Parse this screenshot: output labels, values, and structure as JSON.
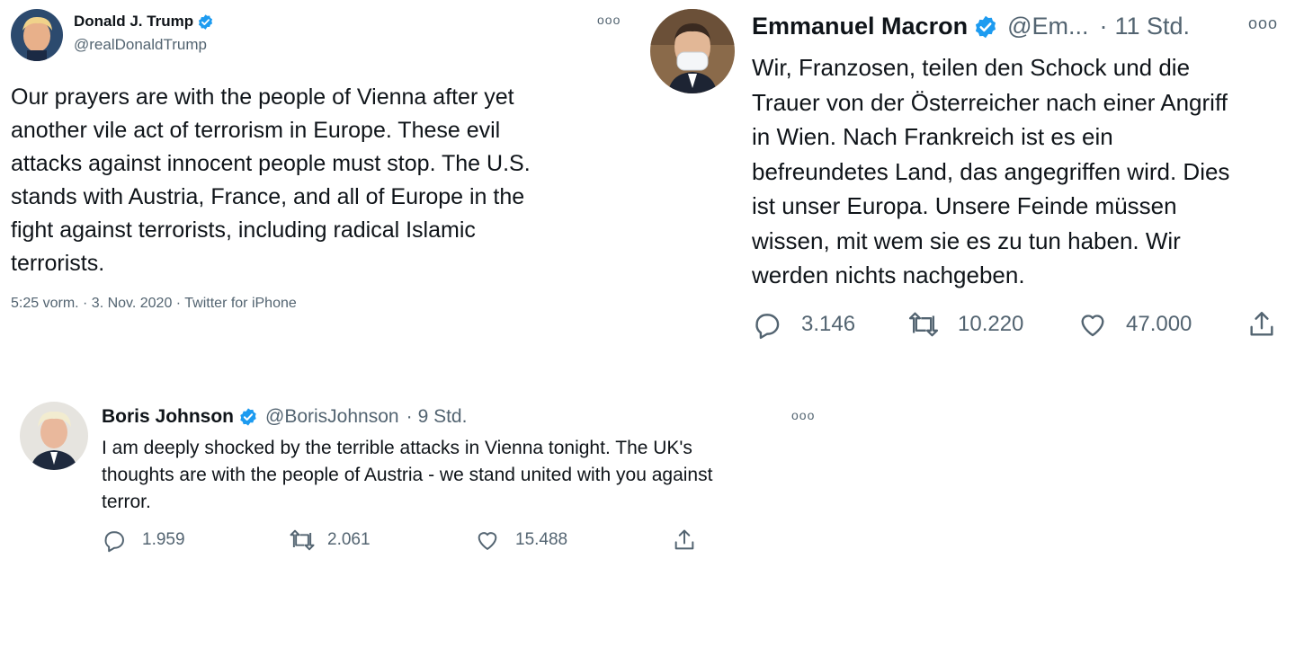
{
  "tweets": [
    {
      "name": "Donald J. Trump",
      "handle": "@realDonaldTrump",
      "more": "ooo",
      "text": "Our prayers are with the people of Vienna after yet\nanother vile act of terrorism in Europe. These evil\nattacks against innocent people must stop. The U.S.\nstands with Austria, France, and all of Europe in the\nfight against terrorists, including radical Islamic\nterrorists.",
      "meta": "5:25 vorm. · 3. Nov. 2020 · Twitter for iPhone",
      "avatar_icon": "portrait-trump"
    },
    {
      "name": "Emmanuel Macron",
      "handle": "@Em...",
      "sep": "·",
      "time": "11 Std.",
      "more": "ooo",
      "text": "Wir, Franzosen, teilen den Schock und die\nTrauer von der Österreicher nach einer Angriff\nin Wien. Nach Frankreich ist es ein\nbefreundetes Land, das angegriffen wird. Dies\nist unser Europa. Unsere Feinde müssen\nwissen, mit wem sie es zu tun haben. Wir\nwerden nichts nachgeben.",
      "replies": "3.146",
      "retweets": "10.220",
      "likes": "47.000",
      "avatar_icon": "portrait-macron"
    },
    {
      "name": "Boris Johnson",
      "handle": "@BorisJohnson",
      "sep": "·",
      "time": "9 Std.",
      "more": "ooo",
      "text": "I am deeply shocked by the terrible attacks in Vienna tonight. The UK's\nthoughts are with the people of Austria - we stand united with you against\nterror.",
      "replies": "1.959",
      "retweets": "2.061",
      "likes": "15.488",
      "avatar_icon": "portrait-johnson"
    }
  ],
  "colors": {
    "verified": "#1d9bf0",
    "secondary_text": "#536471",
    "primary_text": "#0f1419"
  }
}
